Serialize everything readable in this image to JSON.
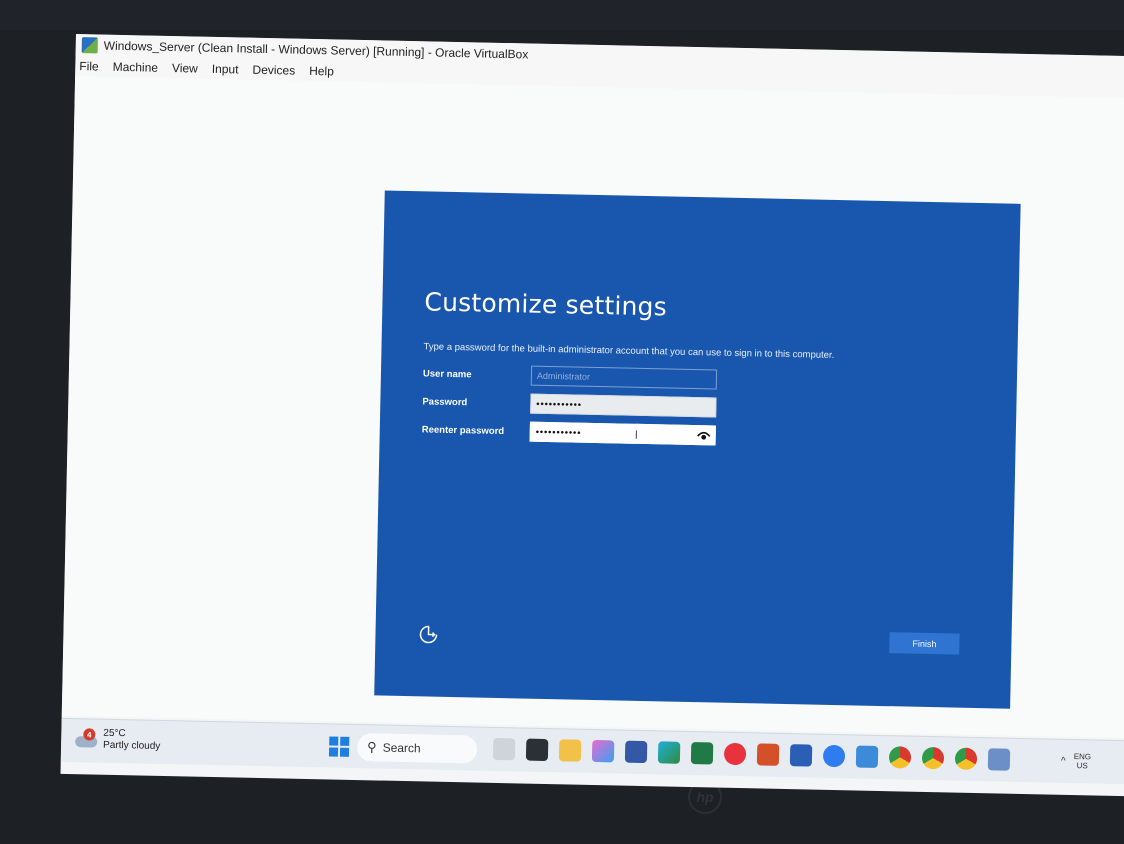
{
  "virtualbox": {
    "title": "Windows_Server (Clean Install - Windows Server) [Running] - Oracle VirtualBox",
    "menu": [
      "File",
      "Machine",
      "View",
      "Input",
      "Devices",
      "Help"
    ]
  },
  "oobe": {
    "title": "Customize settings",
    "description": "Type a password for the built-in administrator account that you can use to sign in to this computer.",
    "fields": {
      "username_label": "User name",
      "username_value": "Administrator",
      "password_label": "Password",
      "password_value": "•••••••••••",
      "reenter_label": "Reenter password",
      "reenter_value": "•••••••••••"
    },
    "finish_label": "Finish",
    "accent_color": "#1957ae"
  },
  "taskbar": {
    "weather_badge": "4",
    "temperature": "25°C",
    "condition": "Partly cloudy",
    "search_label": "Search",
    "language_line1": "ENG",
    "language_line2": "US",
    "pinned_icons": [
      "people-icon",
      "lightshot-icon",
      "file-explorer-icon",
      "copilot-icon",
      "store-icon",
      "edge-icon",
      "excel-icon",
      "opera-icon",
      "powerpoint-icon",
      "word-icon",
      "messenger-icon",
      "vscode-icon",
      "chrome-icon",
      "chrome-profile-icon",
      "chrome-profile-2-icon",
      "virtualbox-icon"
    ]
  }
}
